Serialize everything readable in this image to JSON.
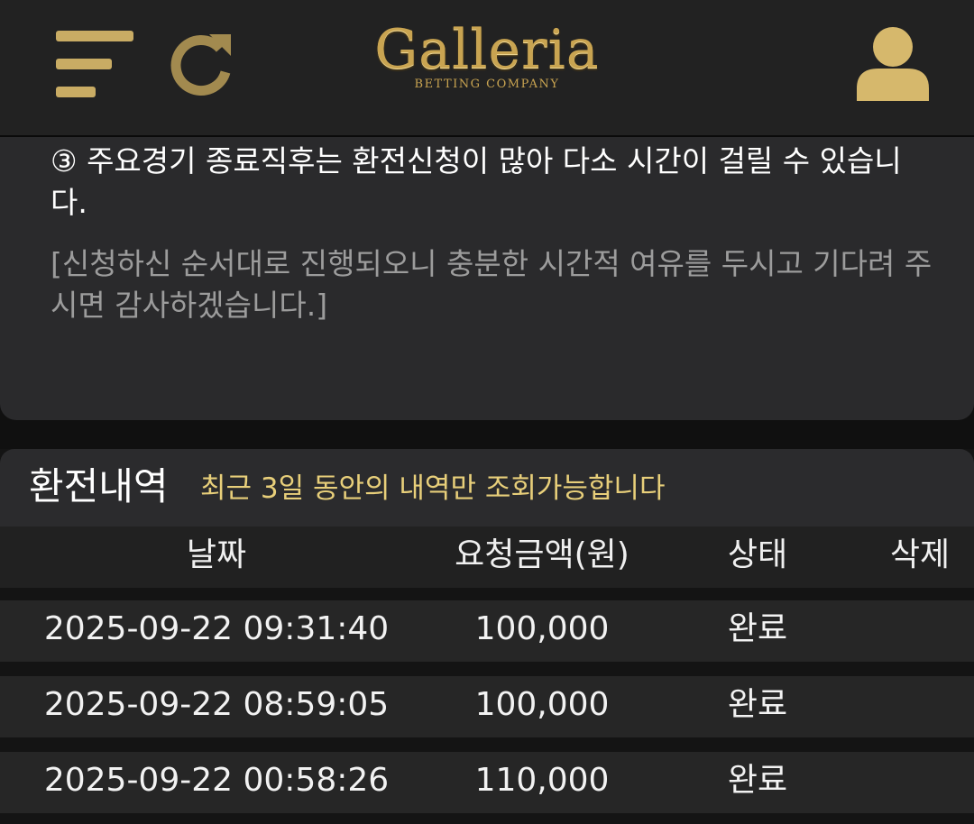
{
  "header": {
    "logo_text": "Galleria",
    "logo_subtext": "BETTING COMPANY",
    "accent_color": "#c9ac64"
  },
  "notice": {
    "item3": "③ 주요경기 종료직후는 환전신청이 많아 다소 시간이 걸릴 수 있습니다.",
    "item3_note": "[신청하신 순서대로 진행되오니 충분한 시간적 여유를 두시고 기다려 주시면 감사하겠습니다.]"
  },
  "history": {
    "title": "환전내역",
    "subtitle": "최근 3일 동안의 내역만 조회가능합니다",
    "columns": {
      "date": "날짜",
      "amount": "요청금액(원)",
      "status": "상태",
      "delete": "삭제"
    },
    "rows": [
      {
        "date": "2025-09-22 09:31:40",
        "amount": "100,000",
        "status": "완료"
      },
      {
        "date": "2025-09-22 08:59:05",
        "amount": "100,000",
        "status": "완료"
      },
      {
        "date": "2025-09-22 00:58:26",
        "amount": "110,000",
        "status": "완료"
      }
    ]
  }
}
